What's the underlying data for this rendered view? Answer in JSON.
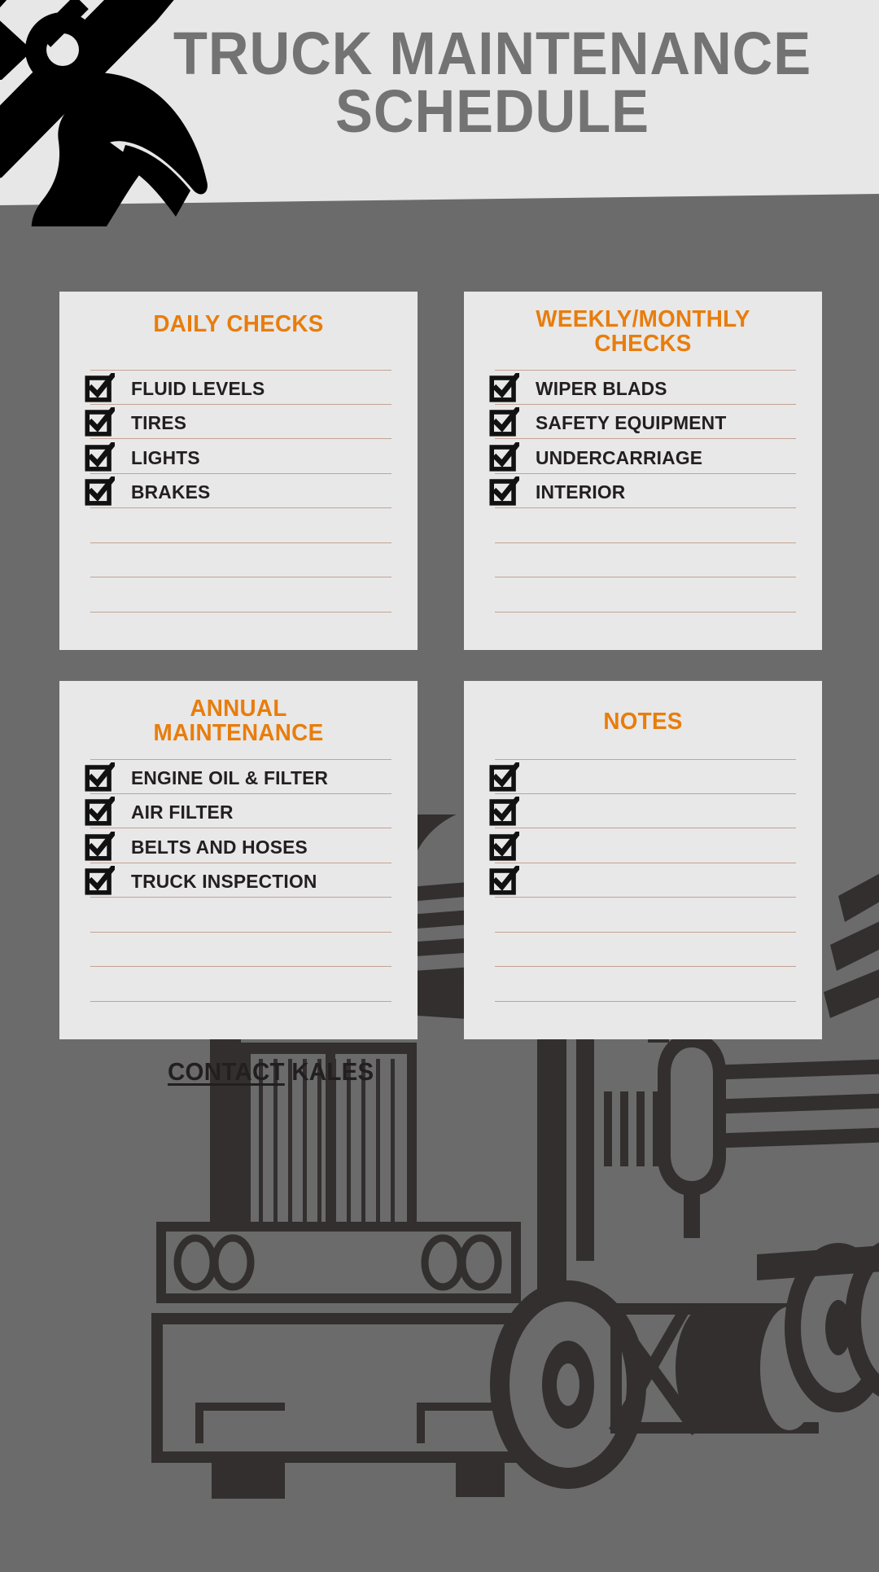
{
  "header": {
    "title": "TRUCK MAINTENANCE\nSCHEDULE",
    "icon": "wrench-hammer-icon"
  },
  "colors": {
    "background": "#6b6b6b",
    "header_band": "#e7e7e7",
    "card_background": "#e8e8e8",
    "accent_orange": "#e87d0d",
    "title_gray": "#737373",
    "rule_line": "#c3a294",
    "text_dark": "#231f20",
    "truck_outline": "#332f2f"
  },
  "cards": [
    {
      "id": "daily-checks",
      "title": "DAILY CHECKS",
      "items": [
        {
          "label": "FLUID LEVELS",
          "checked": true
        },
        {
          "label": "TIRES",
          "checked": true
        },
        {
          "label": "LIGHTS",
          "checked": true
        },
        {
          "label": "BRAKES",
          "checked": true
        },
        {
          "label": "",
          "checked": false
        },
        {
          "label": "",
          "checked": false
        },
        {
          "label": "",
          "checked": false
        }
      ]
    },
    {
      "id": "weekly-monthly-checks",
      "title": "WEEKLY/MONTHLY\nCHECKS",
      "items": [
        {
          "label": "WIPER BLADS",
          "checked": true
        },
        {
          "label": "SAFETY EQUIPMENT",
          "checked": true
        },
        {
          "label": "UNDERCARRIAGE",
          "checked": true
        },
        {
          "label": "INTERIOR",
          "checked": true
        },
        {
          "label": "",
          "checked": false
        },
        {
          "label": "",
          "checked": false
        },
        {
          "label": "",
          "checked": false
        }
      ]
    },
    {
      "id": "annual-maintenance",
      "title": "ANNUAL\nMAINTENANCE",
      "items": [
        {
          "label": "ENGINE OIL & FILTER",
          "checked": true
        },
        {
          "label": "AIR FILTER",
          "checked": true
        },
        {
          "label": "BELTS AND HOSES",
          "checked": true
        },
        {
          "label": "TRUCK INSPECTION",
          "checked": true
        },
        {
          "label": "",
          "checked": false
        },
        {
          "label": "",
          "checked": false
        },
        {
          "label": "",
          "checked": false
        }
      ]
    },
    {
      "id": "notes",
      "title": "NOTES",
      "items": [
        {
          "label": "",
          "checked": true
        },
        {
          "label": "",
          "checked": true
        },
        {
          "label": "",
          "checked": true
        },
        {
          "label": "",
          "checked": true
        },
        {
          "label": "",
          "checked": false
        },
        {
          "label": "",
          "checked": false
        },
        {
          "label": "",
          "checked": false
        }
      ]
    }
  ],
  "footer": {
    "contact_underlined": "CONTACT",
    "contact_rest": " KALES"
  }
}
